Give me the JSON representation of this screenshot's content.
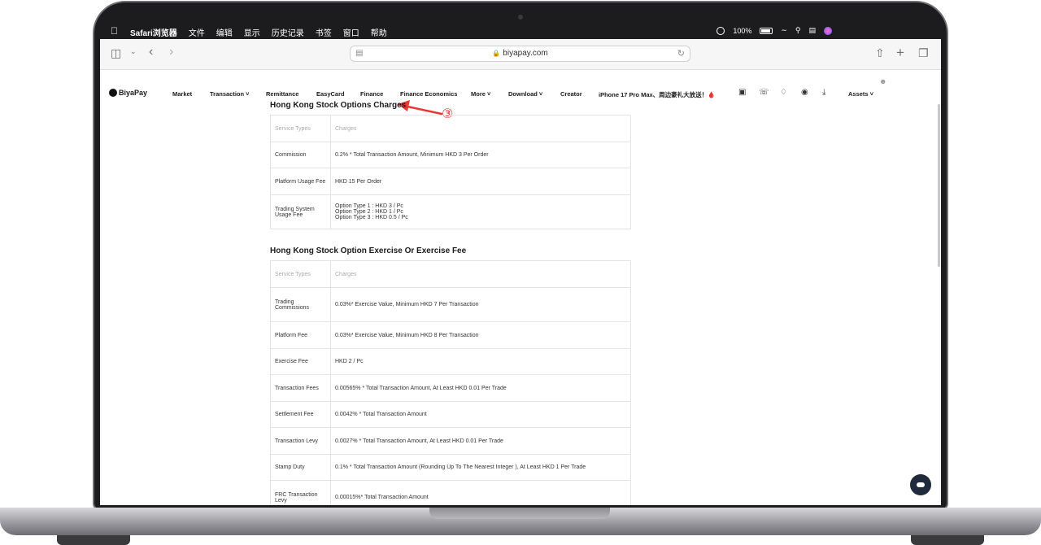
{
  "menubar": {
    "apple": "",
    "items": [
      "Safari浏览器",
      "文件",
      "编辑",
      "显示",
      "历史记录",
      "书签",
      "窗口",
      "帮助"
    ],
    "battery": "100%"
  },
  "browser": {
    "url": "biyapay.com"
  },
  "site": {
    "logo": "BiyaPay",
    "nav": [
      "Market",
      "Transaction ˅",
      "Remittance",
      "EasyCard",
      "Finance",
      "Finance Economics",
      "More ˅",
      "Download ˅",
      "Creator",
      "iPhone 17 Pro Max、周边豪礼大放送！🩸",
      "Assets ˅"
    ]
  },
  "annotation": {
    "number": "③",
    "color": "#e53935"
  },
  "section1": {
    "title": "Hong Kong Stock Options Charges",
    "header": [
      "Service Types",
      "Charges"
    ],
    "rows": [
      {
        "type": "Commission",
        "charge": "0.2% * Total Transaction Amount, Minimum HKD 3 Per Order"
      },
      {
        "type": "Platform Usage Fee",
        "charge": "HKD 15 Per Order"
      },
      {
        "type": "Trading System Usage Fee",
        "charge_lines": [
          "Option Type 1 : HKD 3 / Pc",
          "Option Type 2 : HKD 1 / Pc",
          "Option Type 3 : HKD 0.5 / Pc"
        ]
      }
    ]
  },
  "section2": {
    "title": "Hong Kong Stock Option Exercise Or Exercise Fee",
    "header": [
      "Service Types",
      "Charges"
    ],
    "rows": [
      {
        "type": "Trading Commissions",
        "charge": "0.03%* Exercise Value, Minimum HKD 7 Per Transaction"
      },
      {
        "type": "Platform Fee",
        "charge": "0.03%* Exercise Value, Minimum HKD 8 Per Transaction"
      },
      {
        "type": "Exercise Fee",
        "charge": "HKD 2 / Pc"
      },
      {
        "type": "Transaction Fees",
        "charge": "0.00565% * Total Transaction Amount, At Least HKD 0.01 Per Trade"
      },
      {
        "type": "Settlement Fee",
        "charge": "0.0042% * Total Transaction Amount"
      },
      {
        "type": "Transaction Levy",
        "charge": "0.0027% * Total Transaction Amount, At Least HKD 0.01 Per Trade"
      },
      {
        "type": "Stamp Duty",
        "charge": "0.1% * Total Transaction Amount (Rounding Up To The Nearest Integer ), At Least HKD 1 Per Trade"
      },
      {
        "type": "FRC Transaction Levy",
        "charge": "0.00015%* Total Transaction Amount"
      }
    ]
  }
}
